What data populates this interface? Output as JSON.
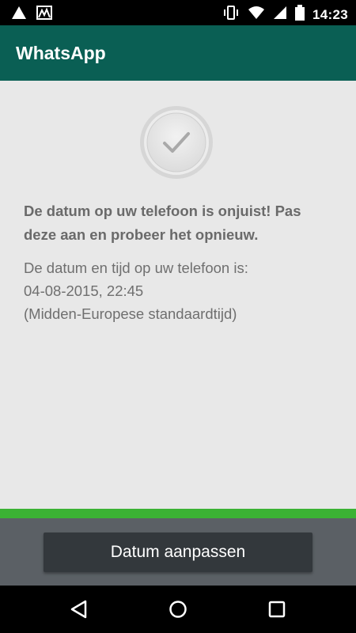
{
  "status_bar": {
    "time": "14:23",
    "left_icons": [
      "warning-icon",
      "photo-notification-icon"
    ],
    "right_icons": [
      "vibrate-icon",
      "wifi-icon",
      "signal-icon",
      "battery-icon"
    ]
  },
  "app_bar": {
    "title": "WhatsApp",
    "color": "#0a5f54"
  },
  "content": {
    "icon": "check-circle-icon",
    "message": "De datum op uw telefoon is onjuist! Pas deze aan en probeer het opnieuw.",
    "detail_line1": "De datum en tijd op uw telefoon is:",
    "detail_line2": "04-08-2015, 22:45",
    "detail_line3": "(Midden-Europese standaardtijd)"
  },
  "accent_color": "#3bb234",
  "action": {
    "button_label": "Datum aanpassen"
  },
  "nav_bar": {
    "icons": [
      "back-icon",
      "home-icon",
      "recents-icon"
    ]
  }
}
